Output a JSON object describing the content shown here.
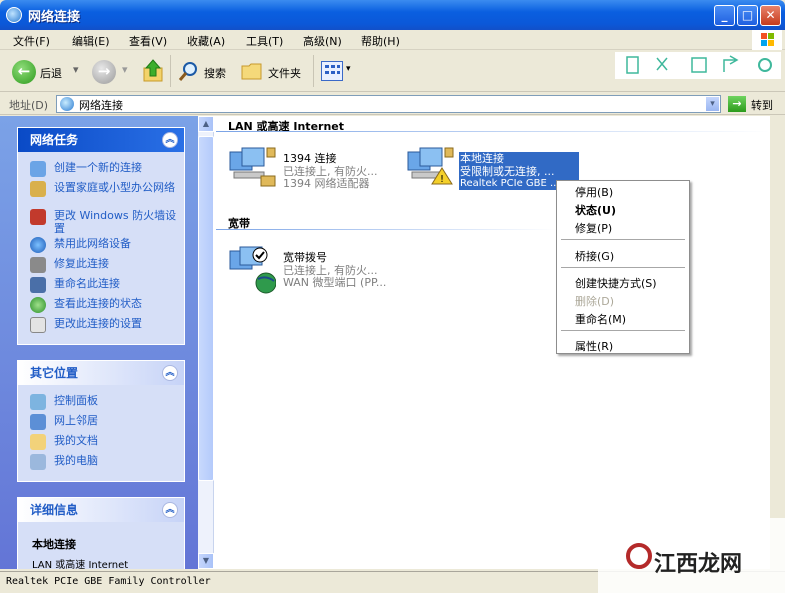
{
  "window": {
    "title": "网络连接",
    "minimize": "_",
    "maximize": "□",
    "close": "✕"
  },
  "menubar": [
    {
      "label": "文件(F)"
    },
    {
      "label": "编辑(E)"
    },
    {
      "label": "查看(V)"
    },
    {
      "label": "收藏(A)"
    },
    {
      "label": "工具(T)"
    },
    {
      "label": "高级(N)"
    },
    {
      "label": "帮助(H)"
    }
  ],
  "toolbar": {
    "back": "后退",
    "search": "搜索",
    "folders": "文件夹"
  },
  "address": {
    "label": "地址(D)",
    "value": "网络连接",
    "go": "转到"
  },
  "tasks_panel": {
    "title": "网络任务",
    "items": [
      {
        "label": "创建一个新的连接"
      },
      {
        "label": "设置家庭或小型办公网络"
      },
      {
        "label": "更改 Windows 防火墙设置"
      },
      {
        "label": "禁用此网络设备"
      },
      {
        "label": "修复此连接"
      },
      {
        "label": "重命名此连接"
      },
      {
        "label": "查看此连接的状态"
      },
      {
        "label": "更改此连接的设置"
      }
    ]
  },
  "places_panel": {
    "title": "其它位置",
    "items": [
      {
        "label": "控制面板"
      },
      {
        "label": "网上邻居"
      },
      {
        "label": "我的文档"
      },
      {
        "label": "我的电脑"
      }
    ]
  },
  "details_panel": {
    "title": "详细信息",
    "name": "本地连接",
    "type": "LAN 或高速 Internet"
  },
  "groups": {
    "lan": "LAN 或高速 Internet",
    "broadband": "宽带"
  },
  "connections": {
    "c1394": {
      "name": "1394 连接",
      "status": "已连接上, 有防火...",
      "device": "1394 网络适配器"
    },
    "local": {
      "name": "本地连接",
      "status": "受限制或无连接, ...",
      "device": "Realtek PCIe GBE ..."
    },
    "broadband": {
      "name": "宽带拨号",
      "status": "已连接上, 有防火...",
      "device": "WAN 微型端口 (PP..."
    }
  },
  "context_menu": [
    {
      "label": "停用(B)"
    },
    {
      "label": "状态(U)"
    },
    {
      "label": "修复(P)"
    },
    {
      "label": "桥接(G)"
    },
    {
      "label": "创建快捷方式(S)"
    },
    {
      "label": "删除(D)"
    },
    {
      "label": "重命名(M)"
    },
    {
      "label": "属性(R)"
    }
  ],
  "statusbar": "Realtek PCIe GBE Family Controller",
  "watermark": "江西龙网",
  "colors": {
    "title_blue": "#0b58d8",
    "task_blue": "#215dc6",
    "selection": "#316ac5"
  }
}
